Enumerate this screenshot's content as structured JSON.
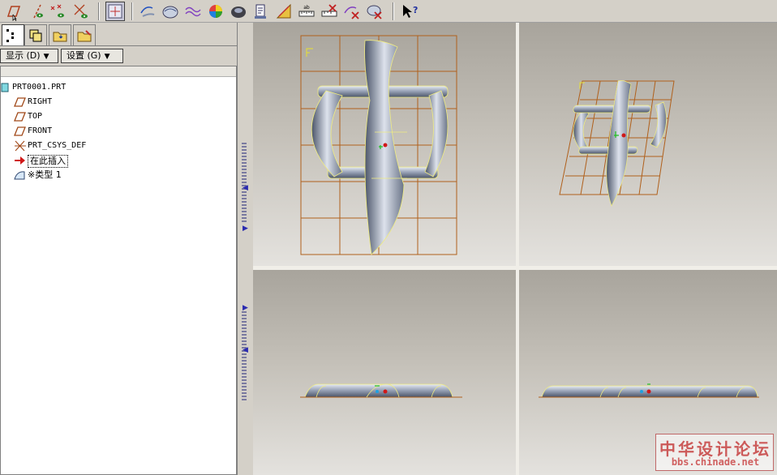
{
  "toolbar": {
    "buttons": [
      {
        "name": "datum-plane-display-button",
        "icon": "datum-plane-icon"
      },
      {
        "name": "datum-axis-display-button",
        "icon": "datum-axis-icon"
      },
      {
        "name": "datum-point-display-button",
        "icon": "datum-point-icon"
      },
      {
        "name": "coordinate-system-display-button",
        "icon": "coordinate-system-icon"
      },
      {
        "name": "spin-center-button",
        "icon": "spin-center-icon"
      },
      {
        "name": "sketch-tool-button",
        "icon": "sketch-icon"
      },
      {
        "name": "surface-tool-button",
        "icon": "surface-icon"
      },
      {
        "name": "curve-tool-button",
        "icon": "curve-icon"
      },
      {
        "name": "shade-color-button",
        "icon": "color-sphere-icon"
      },
      {
        "name": "shade-mode-button",
        "icon": "shaded-model-icon"
      },
      {
        "name": "view-manager-button",
        "icon": "view-manager-icon"
      },
      {
        "name": "analysis-button",
        "icon": "analysis-icon"
      },
      {
        "name": "measure-button",
        "icon": "ruler-icon"
      },
      {
        "name": "measure-delete-button",
        "icon": "ruler-delete-icon"
      },
      {
        "name": "curve-delete-button",
        "icon": "curve-delete-icon"
      },
      {
        "name": "surface-delete-button",
        "icon": "surface-delete-icon"
      },
      {
        "name": "context-help-button",
        "icon": "help-arrow-icon"
      }
    ]
  },
  "panel": {
    "tabs": [
      "model-tree-tab",
      "layers-tab",
      "folder-tab",
      "favorites-tab"
    ],
    "show_menu_label": "显示 (D)",
    "settings_menu_label": "设置 (G)"
  },
  "tree": {
    "items": [
      {
        "label": "PRT0001.PRT",
        "icon": "part-icon"
      },
      {
        "label": "RIGHT",
        "icon": "datum-plane-icon"
      },
      {
        "label": "TOP",
        "icon": "datum-plane-icon"
      },
      {
        "label": "FRONT",
        "icon": "datum-plane-icon"
      },
      {
        "label": "PRT_CSYS_DEF",
        "icon": "coordinate-system-icon"
      },
      {
        "label": "在此插入",
        "icon": "insert-arrow-icon"
      },
      {
        "label": "※类型 1",
        "icon": "style-feature-icon"
      }
    ]
  },
  "viewports": [
    "front-view",
    "isometric-view",
    "top-view",
    "side-view"
  ],
  "watermark": {
    "title": "中华设计论坛",
    "url": "bbs.chinade.net"
  },
  "colors": {
    "grid": "#b0601c",
    "model": "#9ca6b8",
    "model_edge": "#f4f080",
    "accent_red": "#d01818"
  }
}
